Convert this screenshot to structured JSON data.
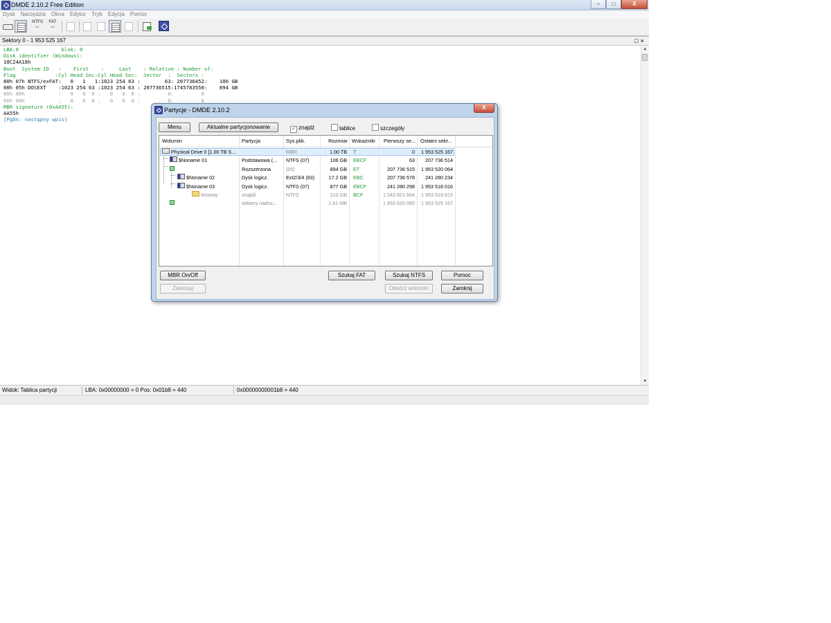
{
  "window": {
    "title": "DMDE 2.10.2 Free Edition",
    "controls": {
      "minimize": "–",
      "maximize": "□",
      "close": "X"
    }
  },
  "menu": [
    "Dysk",
    "Narzędzia",
    "Okna",
    "Edytor",
    "Tryb",
    "Edycja",
    "Pomoc"
  ],
  "toolbar": {
    "ntfs_label": "NTFS",
    "fat_label": "FAT"
  },
  "pane": {
    "header": "Sektory 0 - 1 953 525 167",
    "controls": "□×",
    "lines": [
      {
        "text": "LBA:0              blok: 0",
        "color": "green"
      },
      {
        "text": "Disk identifier (Windows):",
        "color": "green"
      },
      {
        "text": "10C24A18h",
        "color": "black"
      },
      {
        "text": "Boot  System ID   :    First    :     Last    : Relative : Number of:",
        "color": "green"
      },
      {
        "text": "Flag             :Cyl Head Sec:Cyl Head Sec:  Sector  :  Sectors :",
        "color": "green"
      },
      {
        "text": "80h 07h NTFS/exFAT:   0   1   1:1023 254 63 :        63: 207736452:    106 GB",
        "color": "black"
      },
      {
        "text": "00h 05h DOSEXT    :1023 254 63 :1023 254 63 : 207736515:1745783550:    894 GB",
        "color": "black"
      },
      {
        "text": "00h 00h           :   0   0  0 :   0   0  0 :         0:         0",
        "color": "gray"
      },
      {
        "text": "00h 00h           :   0   0  0 :   0   0  0 :         0:         0",
        "color": "gray"
      },
      {
        "text": "MBR signature (0xAA55):",
        "color": "green"
      },
      {
        "text": "AA55h",
        "color": "black"
      },
      {
        "text": "[PgDn: następny wpis]",
        "color": "blue"
      }
    ]
  },
  "statusbar": {
    "view": "Widok: Tablica partycji",
    "lba": "LBA: 0x00000000 = 0  Pos: 0x01b8 = 440",
    "offset": "0x00000000001b8 = 440"
  },
  "dialog": {
    "title": "Partycje - DMDE 2.10.2",
    "close": "X",
    "menu_button": "Menu",
    "current_partitioning_button": "Aktualne partycjonowanie",
    "checkboxes": [
      {
        "label": "znajdź",
        "checked": true
      },
      {
        "label": "tablice",
        "checked": false
      },
      {
        "label": "szczegóły",
        "checked": false
      }
    ],
    "columns": [
      "Wolumin",
      "Partycja",
      "Sys.plik.",
      "Rozmiar",
      "Wskaźniki",
      "Pierwszy se...",
      "Ostatni sekt..."
    ],
    "rows": [
      {
        "name": "Physical Drive 0 [1.00 TB S...",
        "partition": "",
        "fs": "MBR",
        "size": "1.00 TB",
        "flags": "T",
        "first": "0",
        "last": "1 953 525 167",
        "selected": true,
        "icon": "drive-icon"
      },
      {
        "name": "$Noname 01",
        "partition": "Podstawowa (...",
        "fs": "NTFS (07)",
        "size": "106 GB",
        "flags": "EBCF",
        "first": "63",
        "last": "207 736 514",
        "selected": false,
        "icon": "partition-icon"
      },
      {
        "name": "",
        "partition": "Rozszerzona",
        "fs": "(05)",
        "size": "894 GB",
        "flags": "ET",
        "first": "207 736 515",
        "last": "1 953 520 064",
        "selected": false,
        "icon": "extended-icon"
      },
      {
        "name": "$Noname 02",
        "partition": "Dysk logicz.",
        "fs": "Ext2/3/4 (83)",
        "size": "17.2 GB",
        "flags": "EBC",
        "first": "207 736 578",
        "last": "241 280 234",
        "selected": false,
        "icon": "partition-icon"
      },
      {
        "name": "$Noname 03",
        "partition": "Dysk logicz.",
        "fs": "NTFS (07)",
        "size": "877 GB",
        "flags": "EBCF",
        "first": "241 280 298",
        "last": "1 953 518 016",
        "selected": false,
        "icon": "partition-icon"
      },
      {
        "name": "testowy",
        "partition": "znajdź",
        "fs": "NTFS",
        "size": "210 GB",
        "flags": "BCF",
        "first": "1 543 921 664",
        "last": "1 953 519 615",
        "selected": false,
        "icon": "folder-icon"
      },
      {
        "name": "",
        "partition": "sektory nadmi...",
        "fs": "",
        "size": "2.61 MB",
        "flags": "",
        "first": "1 953 520 065",
        "last": "1 953 525 167",
        "selected": false,
        "icon": "free-space-icon"
      }
    ],
    "buttons": {
      "mbr": "MBR On/Off",
      "apply": "Zastosuj",
      "search_fat": "Szukaj FAT",
      "search_ntfs": "Szukaj NTFS",
      "help": "Pomoc",
      "open_volume": "Otwórz wolumin",
      "close": "Zamknij"
    }
  }
}
